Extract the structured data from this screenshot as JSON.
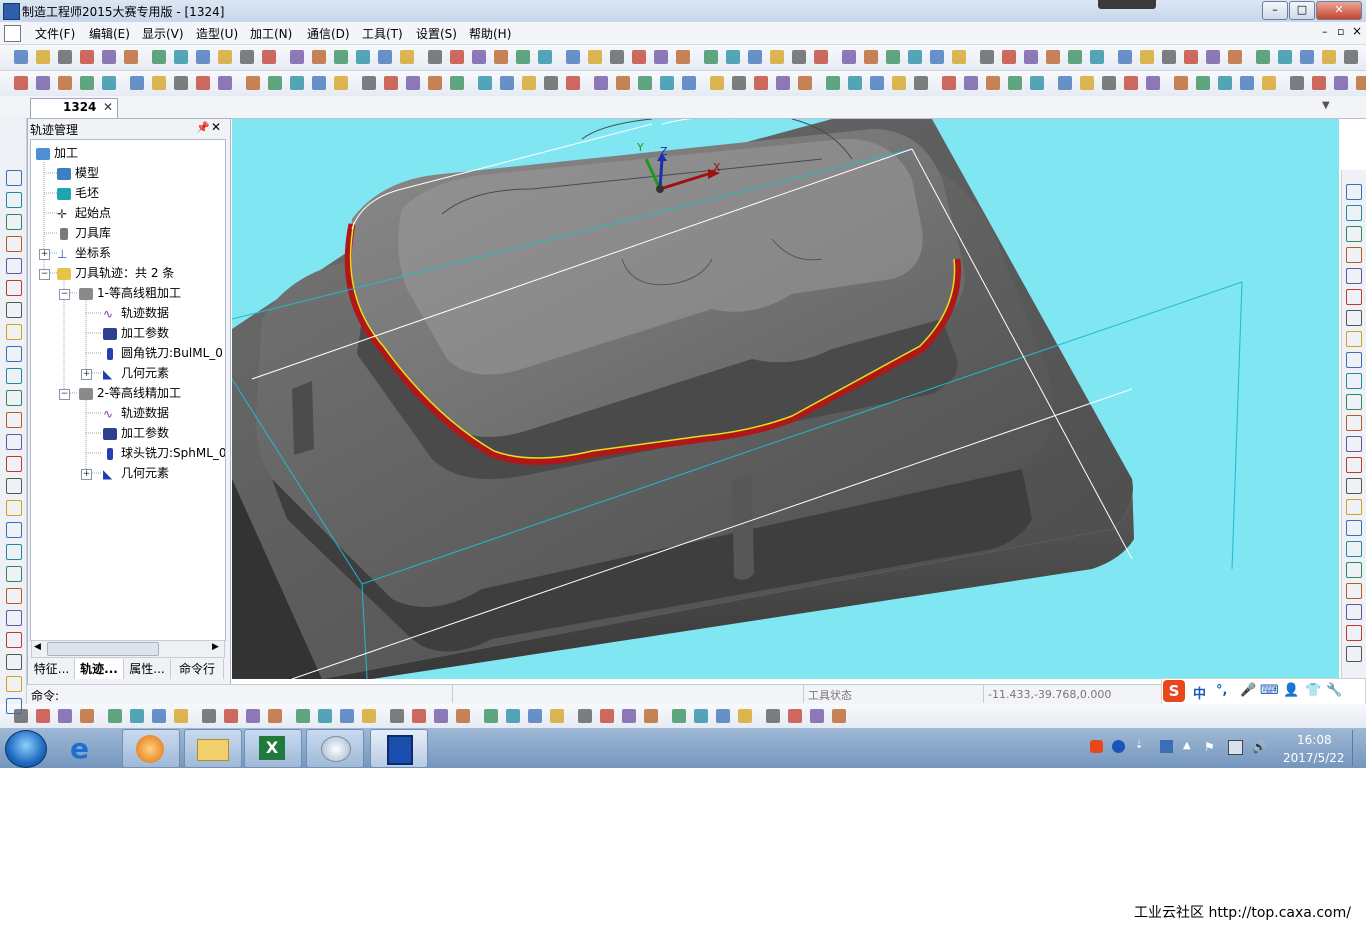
{
  "window": {
    "title": "制造工程师2015大赛专用版 - [1324]"
  },
  "menu": [
    "文件(F)",
    "编辑(E)",
    "显示(V)",
    "造型(U)",
    "加工(N)",
    "通信(D)",
    "工具(T)",
    "设置(S)",
    "帮助(H)"
  ],
  "tabs": {
    "document": "1324"
  },
  "panel": {
    "title": "轨迹管理",
    "tree": {
      "root": "加工",
      "model": "模型",
      "blank": "毛坯",
      "start_point": "起始点",
      "tool_library": "刀具库",
      "coordinate_system": "坐标系",
      "toolpaths": "刀具轨迹：共 2 条",
      "op1": {
        "name": "1-等高线粗加工",
        "data": "轨迹数据",
        "params": "加工参数",
        "tool": "圆角铣刀:BulML_0",
        "geometry": "几何元素"
      },
      "op2": {
        "name": "2-等高线精加工",
        "data": "轨迹数据",
        "params": "加工参数",
        "tool": "球头铣刀:SphML_0",
        "geometry": "几何元素"
      }
    },
    "bottom_tabs": [
      "特征...",
      "轨迹...",
      "属性...",
      "命令行"
    ]
  },
  "axes": {
    "x": "X",
    "y": "Y",
    "z": "Z"
  },
  "command_bar": {
    "label": "命令:",
    "tool_status": "工具状态",
    "coordinates": "-11.433,-39.768,0.000"
  },
  "ime": {
    "logo": "S",
    "mode": "中"
  },
  "taskbar": {
    "time": "16:08",
    "date": "2017/5/22"
  },
  "watermark": "工业云社区 http://top.caxa.com/",
  "colors": {
    "viewport_bg": "#7fe6f2",
    "model_gray": "#5a5a5a",
    "toolpath_red": "#b01818",
    "toolpath_yellow": "#e6e020",
    "accent": "#2d5fa8"
  }
}
